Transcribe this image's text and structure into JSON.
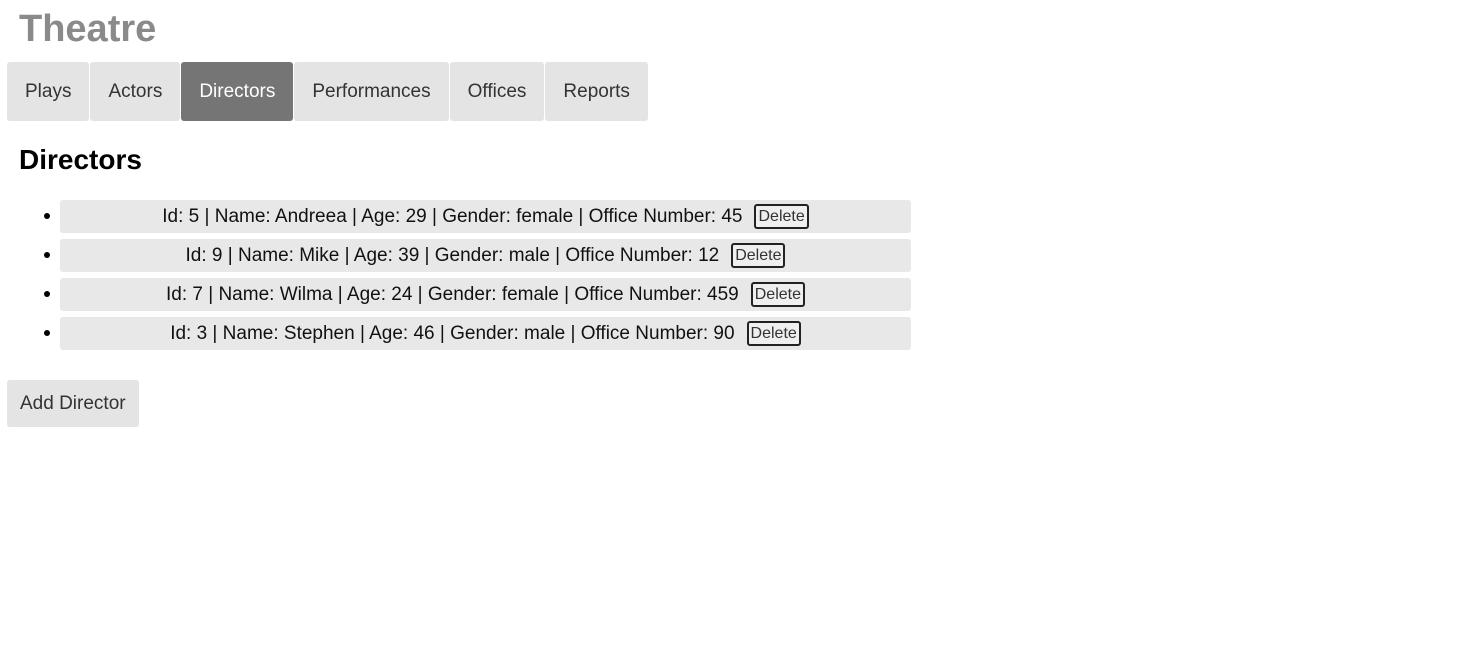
{
  "app": {
    "title": "Theatre"
  },
  "tabs": [
    {
      "label": "Plays",
      "active": false
    },
    {
      "label": "Actors",
      "active": false
    },
    {
      "label": "Directors",
      "active": true
    },
    {
      "label": "Performances",
      "active": false
    },
    {
      "label": "Offices",
      "active": false
    },
    {
      "label": "Reports",
      "active": false
    }
  ],
  "main": {
    "heading": "Directors",
    "directors": [
      {
        "text": "Id: 5 | Name: Andreea | Age: 29 | Gender: female | Office Number: 45",
        "delete_label": "Delete"
      },
      {
        "text": "Id: 9 | Name: Mike | Age: 39 | Gender: male | Office Number: 12",
        "delete_label": "Delete"
      },
      {
        "text": "Id: 7 | Name: Wilma | Age: 24 | Gender: female | Office Number: 459",
        "delete_label": "Delete"
      },
      {
        "text": "Id: 3 | Name: Stephen | Age: 46 | Gender: male | Office Number: 90",
        "delete_label": "Delete"
      }
    ],
    "add_label": "Add Director"
  },
  "colors": {
    "title": "#8a8a8a",
    "tab_bg": "#e4e4e4",
    "tab_active_bg": "#757575",
    "item_bg": "#e8e8e8"
  }
}
